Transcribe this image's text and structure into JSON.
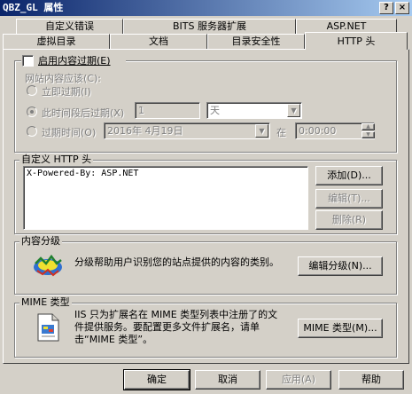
{
  "window": {
    "title": "QBZ_GL 属性",
    "help_glyph": "?",
    "close_glyph": "×"
  },
  "tabs_back_row": [
    {
      "label": "自定义错误"
    },
    {
      "label": "BITS 服务器扩展"
    },
    {
      "label": "ASP.NET"
    }
  ],
  "tabs_front_row": [
    {
      "label": "虚拟目录"
    },
    {
      "label": "文档"
    },
    {
      "label": "目录安全性"
    },
    {
      "label": "HTTP 头",
      "active": true
    }
  ],
  "expiration": {
    "checkbox_label": "启用内容过期(E)",
    "checked": false,
    "sub_label": "网站内容应该(C):",
    "immediately": "立即过期(I)",
    "after": "此时间段后过期(X)",
    "after_value": "1",
    "after_unit": "天",
    "on": "过期时间(O)",
    "date_value": "2016年 4月19日",
    "at_label": "在",
    "time_value": "0:00:00"
  },
  "custom_headers": {
    "group_label": "自定义 HTTP 头",
    "items": [
      "X-Powered-By: ASP.NET"
    ],
    "add": "添加(D)...",
    "edit": "编辑(T)...",
    "remove": "删除(R)"
  },
  "ratings": {
    "group_label": "内容分级",
    "description": "分级帮助用户识别您的站点提供的内容的类别。",
    "edit": "编辑分级(N)..."
  },
  "mime": {
    "group_label": "MIME 类型",
    "description": "IIS 只为扩展名在 MIME 类型列表中注册了的文件提供服务。要配置更多文件扩展名，请单击“MIME 类型”。",
    "button": "MIME 类型(M)..."
  },
  "footer": {
    "ok": "确定",
    "cancel": "取消",
    "apply": "应用(A)",
    "help": "帮助"
  }
}
